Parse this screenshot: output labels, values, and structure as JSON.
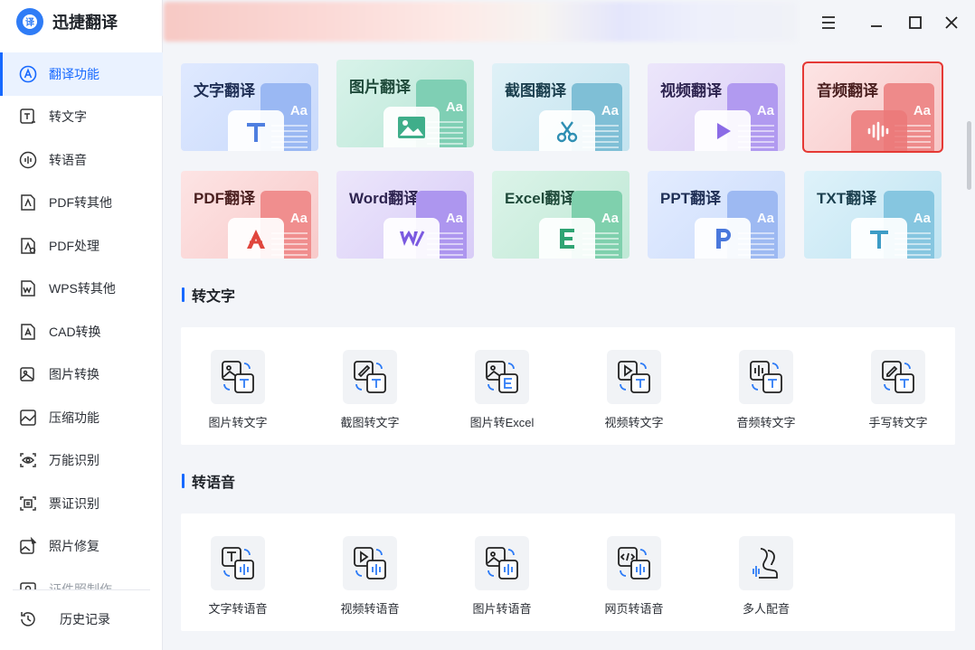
{
  "app": {
    "name": "迅捷翻译",
    "logo_glyph": "译",
    "accent": "#1769ff"
  },
  "sidebar": {
    "items": [
      {
        "label": "翻译功能",
        "icon": "translate-icon",
        "active": true
      },
      {
        "label": "转文字",
        "icon": "text-convert-icon"
      },
      {
        "label": "转语音",
        "icon": "voice-icon"
      },
      {
        "label": "PDF转其他",
        "icon": "pdf-convert-icon"
      },
      {
        "label": "PDF处理",
        "icon": "pdf-process-icon"
      },
      {
        "label": "WPS转其他",
        "icon": "wps-icon"
      },
      {
        "label": "CAD转换",
        "icon": "cad-icon"
      },
      {
        "label": "图片转换",
        "icon": "image-convert-icon"
      },
      {
        "label": "压缩功能",
        "icon": "compress-icon"
      },
      {
        "label": "万能识别",
        "icon": "eye-icon"
      },
      {
        "label": "票证识别",
        "icon": "ticket-icon"
      },
      {
        "label": "照片修复",
        "icon": "photo-repair-icon"
      },
      {
        "label": "证件照制作",
        "icon": "id-photo-icon"
      }
    ],
    "history_label": "历史记录"
  },
  "translate_cards": [
    {
      "label": "文字翻译",
      "icon": "T",
      "theme": "blue"
    },
    {
      "label": "图片翻译",
      "icon": "image",
      "theme": "green"
    },
    {
      "label": "截图翻译",
      "icon": "scissors",
      "theme": "teal"
    },
    {
      "label": "视频翻译",
      "icon": "play",
      "theme": "purple"
    },
    {
      "label": "音频翻译",
      "icon": "audio",
      "theme": "red",
      "selected": true
    },
    {
      "label": "PDF翻译",
      "icon": "pdf",
      "theme": "red"
    },
    {
      "label": "Word翻译",
      "icon": "word",
      "theme": "purple"
    },
    {
      "label": "Excel翻译",
      "icon": "E",
      "theme": "green"
    },
    {
      "label": "PPT翻译",
      "icon": "P",
      "theme": "blue"
    },
    {
      "label": "TXT翻译",
      "icon": "T",
      "theme": "cyan"
    }
  ],
  "card_aa": "Aa",
  "sections": {
    "to_text": {
      "title": "转文字",
      "tools": [
        "图片转文字",
        "截图转文字",
        "图片转Excel",
        "视频转文字",
        "音频转文字",
        "手写转文字"
      ]
    },
    "to_speech": {
      "title": "转语音",
      "tools": [
        "文字转语音",
        "视频转语音",
        "图片转语音",
        "网页转语音",
        "多人配音"
      ]
    }
  }
}
